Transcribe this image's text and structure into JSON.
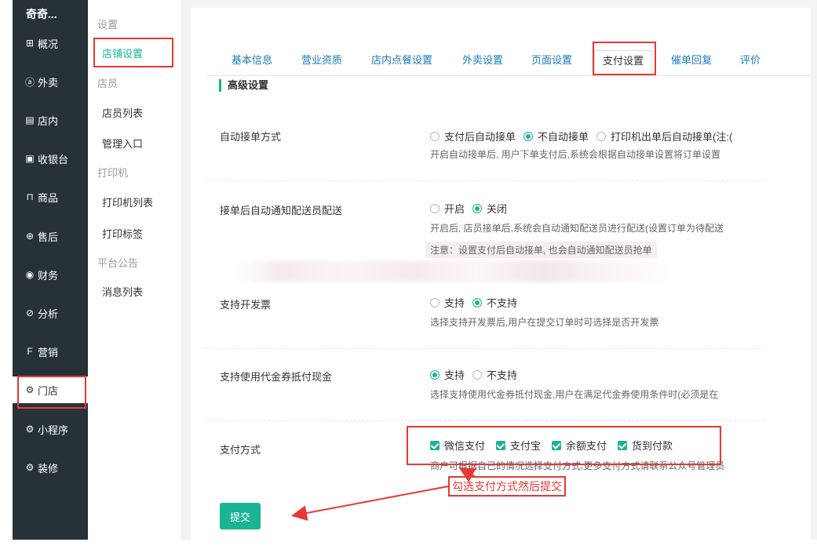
{
  "brand": "奇奇...",
  "sidebar": {
    "items": [
      {
        "label": "概况",
        "icon": "dashboard-icon",
        "glyph": "⊞"
      },
      {
        "label": "外卖",
        "icon": "delivery-icon",
        "glyph": "ⓐ"
      },
      {
        "label": "店内",
        "icon": "store-icon",
        "glyph": "▤"
      },
      {
        "label": "收银台",
        "icon": "cashier-icon",
        "glyph": "▣"
      },
      {
        "label": "商品",
        "icon": "goods-icon",
        "glyph": "⊓"
      },
      {
        "label": "售后",
        "icon": "aftersale-icon",
        "glyph": "⊕"
      },
      {
        "label": "财务",
        "icon": "finance-icon",
        "glyph": "◉"
      },
      {
        "label": "分析",
        "icon": "analysis-icon",
        "glyph": "⊘"
      },
      {
        "label": "营销",
        "icon": "marketing-icon",
        "glyph": "F"
      },
      {
        "label": "门店",
        "icon": "gear-icon",
        "glyph": "⚙"
      },
      {
        "label": "小程序",
        "icon": "gear-icon",
        "glyph": "⚙"
      },
      {
        "label": "装修",
        "icon": "gear-icon",
        "glyph": "⚙"
      }
    ],
    "active": "门店"
  },
  "subnav": {
    "groups": [
      "设置",
      "店员",
      "打印机",
      "平台公告"
    ],
    "items": [
      "店铺设置",
      "店员列表",
      "管理入口",
      "打印机列表",
      "打印标签",
      "消息列表"
    ],
    "active": "店铺设置"
  },
  "tabs": [
    "基本信息",
    "营业资质",
    "店内点餐设置",
    "外卖设置",
    "页面设置",
    "支付设置",
    "催单回复",
    "评价"
  ],
  "active_tab": "支付设置",
  "section_title": "高级设置",
  "rows": {
    "auto_accept": {
      "label": "自动接单方式",
      "options": [
        "支付后自动接单",
        "不自动接单",
        "打印机出单后自动接单(注:("
      ],
      "selected": "不自动接单",
      "help": "开启自动接单后, 用户下单支付后,系统会根据自动接单设置将订单设置"
    },
    "notify_courier": {
      "label": "接单后自动通知配送员配送",
      "options": [
        "开启",
        "关闭"
      ],
      "selected": "关闭",
      "help": "开启后, 店员接单后,系统会自动通知配送员进行配送(设置订单为待配送",
      "note": "注意：设置支付后自动接单, 也会自动通知配送员抢单"
    },
    "invoice": {
      "label": "支持开发票",
      "options": [
        "支持",
        "不支持"
      ],
      "selected": "不支持",
      "help": "选择支持开发票后,用户在提交订单时可选择是否开发票"
    },
    "voucher": {
      "label": "支持使用代金券抵付现金",
      "options": [
        "支持",
        "不支持"
      ],
      "selected": "支持",
      "help": "选择支持使用代金券抵付现金,用户在满足代金券使用条件时(必须是在"
    },
    "payment": {
      "label": "支付方式",
      "options": [
        "微信支付",
        "支付宝",
        "余额支付",
        "货到付款"
      ],
      "help": "商户可根据自己的情况选择支付方式,更多支付方式请联系公众号管理员"
    }
  },
  "submit_label": "提交",
  "annotation": "勾选支付方式然后提交",
  "colors": {
    "accent": "#1ab394",
    "sidebar_bg": "#263238",
    "highlight": "#e53935",
    "tab_link": "#1a7bb9"
  }
}
